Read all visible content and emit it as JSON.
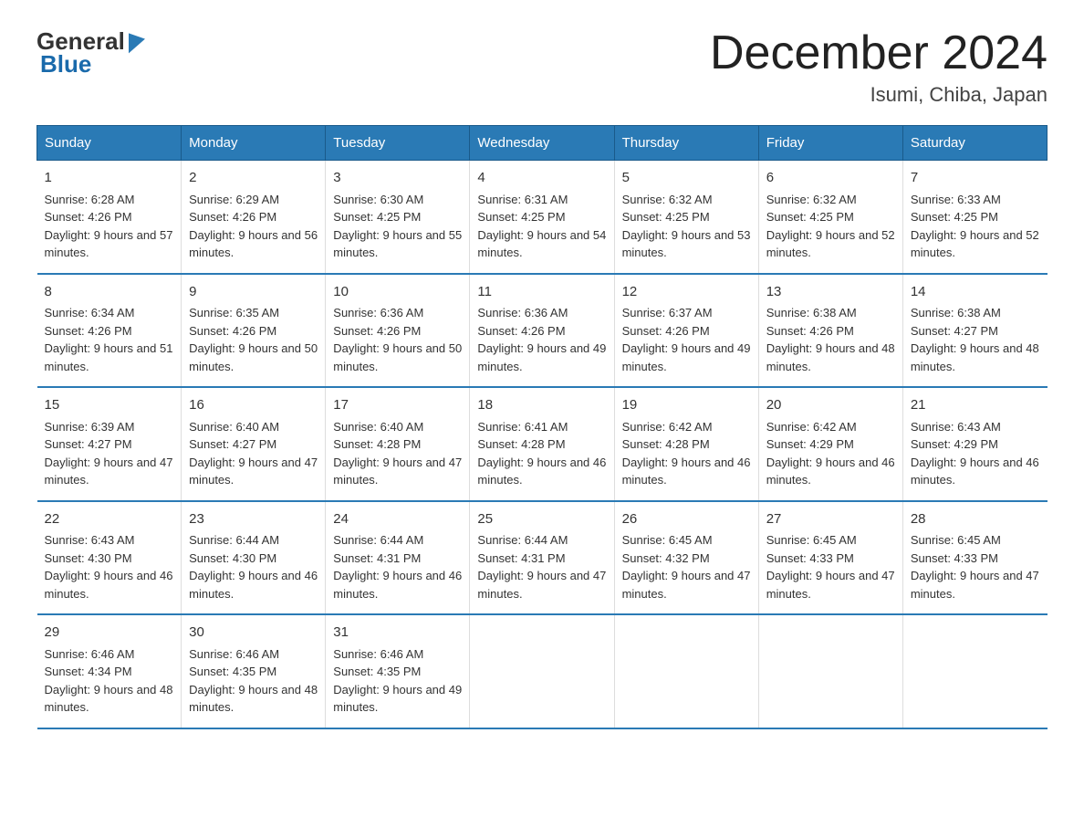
{
  "header": {
    "logo_general": "General",
    "logo_blue": "Blue",
    "main_title": "December 2024",
    "subtitle": "Isumi, Chiba, Japan"
  },
  "calendar": {
    "days_of_week": [
      "Sunday",
      "Monday",
      "Tuesday",
      "Wednesday",
      "Thursday",
      "Friday",
      "Saturday"
    ],
    "weeks": [
      [
        {
          "date": "1",
          "sunrise": "6:28 AM",
          "sunset": "4:26 PM",
          "daylight": "9 hours and 57 minutes."
        },
        {
          "date": "2",
          "sunrise": "6:29 AM",
          "sunset": "4:26 PM",
          "daylight": "9 hours and 56 minutes."
        },
        {
          "date": "3",
          "sunrise": "6:30 AM",
          "sunset": "4:25 PM",
          "daylight": "9 hours and 55 minutes."
        },
        {
          "date": "4",
          "sunrise": "6:31 AM",
          "sunset": "4:25 PM",
          "daylight": "9 hours and 54 minutes."
        },
        {
          "date": "5",
          "sunrise": "6:32 AM",
          "sunset": "4:25 PM",
          "daylight": "9 hours and 53 minutes."
        },
        {
          "date": "6",
          "sunrise": "6:32 AM",
          "sunset": "4:25 PM",
          "daylight": "9 hours and 52 minutes."
        },
        {
          "date": "7",
          "sunrise": "6:33 AM",
          "sunset": "4:25 PM",
          "daylight": "9 hours and 52 minutes."
        }
      ],
      [
        {
          "date": "8",
          "sunrise": "6:34 AM",
          "sunset": "4:26 PM",
          "daylight": "9 hours and 51 minutes."
        },
        {
          "date": "9",
          "sunrise": "6:35 AM",
          "sunset": "4:26 PM",
          "daylight": "9 hours and 50 minutes."
        },
        {
          "date": "10",
          "sunrise": "6:36 AM",
          "sunset": "4:26 PM",
          "daylight": "9 hours and 50 minutes."
        },
        {
          "date": "11",
          "sunrise": "6:36 AM",
          "sunset": "4:26 PM",
          "daylight": "9 hours and 49 minutes."
        },
        {
          "date": "12",
          "sunrise": "6:37 AM",
          "sunset": "4:26 PM",
          "daylight": "9 hours and 49 minutes."
        },
        {
          "date": "13",
          "sunrise": "6:38 AM",
          "sunset": "4:26 PM",
          "daylight": "9 hours and 48 minutes."
        },
        {
          "date": "14",
          "sunrise": "6:38 AM",
          "sunset": "4:27 PM",
          "daylight": "9 hours and 48 minutes."
        }
      ],
      [
        {
          "date": "15",
          "sunrise": "6:39 AM",
          "sunset": "4:27 PM",
          "daylight": "9 hours and 47 minutes."
        },
        {
          "date": "16",
          "sunrise": "6:40 AM",
          "sunset": "4:27 PM",
          "daylight": "9 hours and 47 minutes."
        },
        {
          "date": "17",
          "sunrise": "6:40 AM",
          "sunset": "4:28 PM",
          "daylight": "9 hours and 47 minutes."
        },
        {
          "date": "18",
          "sunrise": "6:41 AM",
          "sunset": "4:28 PM",
          "daylight": "9 hours and 46 minutes."
        },
        {
          "date": "19",
          "sunrise": "6:42 AM",
          "sunset": "4:28 PM",
          "daylight": "9 hours and 46 minutes."
        },
        {
          "date": "20",
          "sunrise": "6:42 AM",
          "sunset": "4:29 PM",
          "daylight": "9 hours and 46 minutes."
        },
        {
          "date": "21",
          "sunrise": "6:43 AM",
          "sunset": "4:29 PM",
          "daylight": "9 hours and 46 minutes."
        }
      ],
      [
        {
          "date": "22",
          "sunrise": "6:43 AM",
          "sunset": "4:30 PM",
          "daylight": "9 hours and 46 minutes."
        },
        {
          "date": "23",
          "sunrise": "6:44 AM",
          "sunset": "4:30 PM",
          "daylight": "9 hours and 46 minutes."
        },
        {
          "date": "24",
          "sunrise": "6:44 AM",
          "sunset": "4:31 PM",
          "daylight": "9 hours and 46 minutes."
        },
        {
          "date": "25",
          "sunrise": "6:44 AM",
          "sunset": "4:31 PM",
          "daylight": "9 hours and 47 minutes."
        },
        {
          "date": "26",
          "sunrise": "6:45 AM",
          "sunset": "4:32 PM",
          "daylight": "9 hours and 47 minutes."
        },
        {
          "date": "27",
          "sunrise": "6:45 AM",
          "sunset": "4:33 PM",
          "daylight": "9 hours and 47 minutes."
        },
        {
          "date": "28",
          "sunrise": "6:45 AM",
          "sunset": "4:33 PM",
          "daylight": "9 hours and 47 minutes."
        }
      ],
      [
        {
          "date": "29",
          "sunrise": "6:46 AM",
          "sunset": "4:34 PM",
          "daylight": "9 hours and 48 minutes."
        },
        {
          "date": "30",
          "sunrise": "6:46 AM",
          "sunset": "4:35 PM",
          "daylight": "9 hours and 48 minutes."
        },
        {
          "date": "31",
          "sunrise": "6:46 AM",
          "sunset": "4:35 PM",
          "daylight": "9 hours and 49 minutes."
        },
        null,
        null,
        null,
        null
      ]
    ]
  }
}
